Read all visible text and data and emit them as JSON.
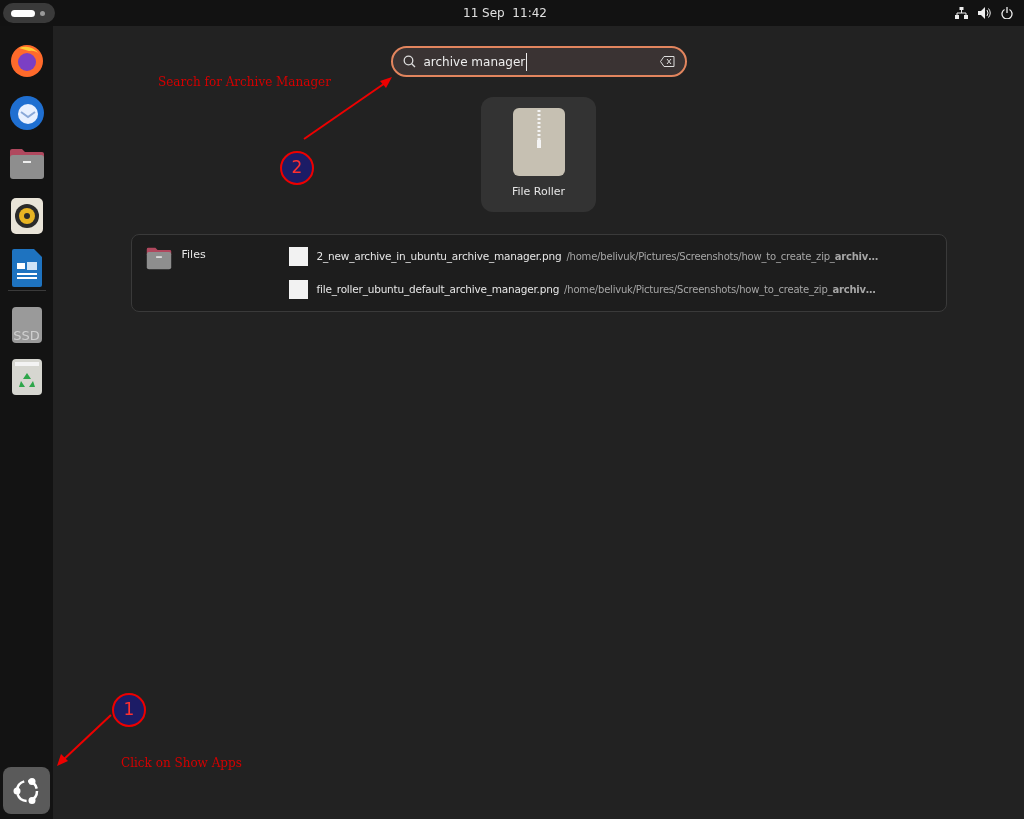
{
  "top_bar": {
    "clock": "11 Sep  11:42"
  },
  "dock": {
    "items": [
      {
        "kind": "browser"
      },
      {
        "kind": "mail"
      },
      {
        "kind": "files"
      },
      {
        "kind": "music"
      },
      {
        "kind": "writer"
      },
      {
        "kind": "drive",
        "label": "SSD"
      },
      {
        "kind": "trash"
      }
    ],
    "show_apps": {
      "kind": "apps"
    }
  },
  "search": {
    "value": "archive manager"
  },
  "app_results": [
    {
      "name": "File Roller"
    }
  ],
  "file_results": {
    "provider": "Files",
    "items": [
      {
        "name": "2_new_archive_in_ubuntu_archive_manager.png",
        "path": "/home/belivuk/Pictures/Screenshots/how_to_create_zip_**archiv…**"
      },
      {
        "name": "file_roller_ubuntu_default_archive_manager.png",
        "path": "/home/belivuk/Pictures/Screenshots/how_to_create_zip_**archiv…**"
      }
    ]
  },
  "annotations": [
    {
      "number": "2",
      "text": "Search for Archive Manager"
    },
    {
      "number": "1",
      "text": "Click on Show Apps"
    }
  ]
}
